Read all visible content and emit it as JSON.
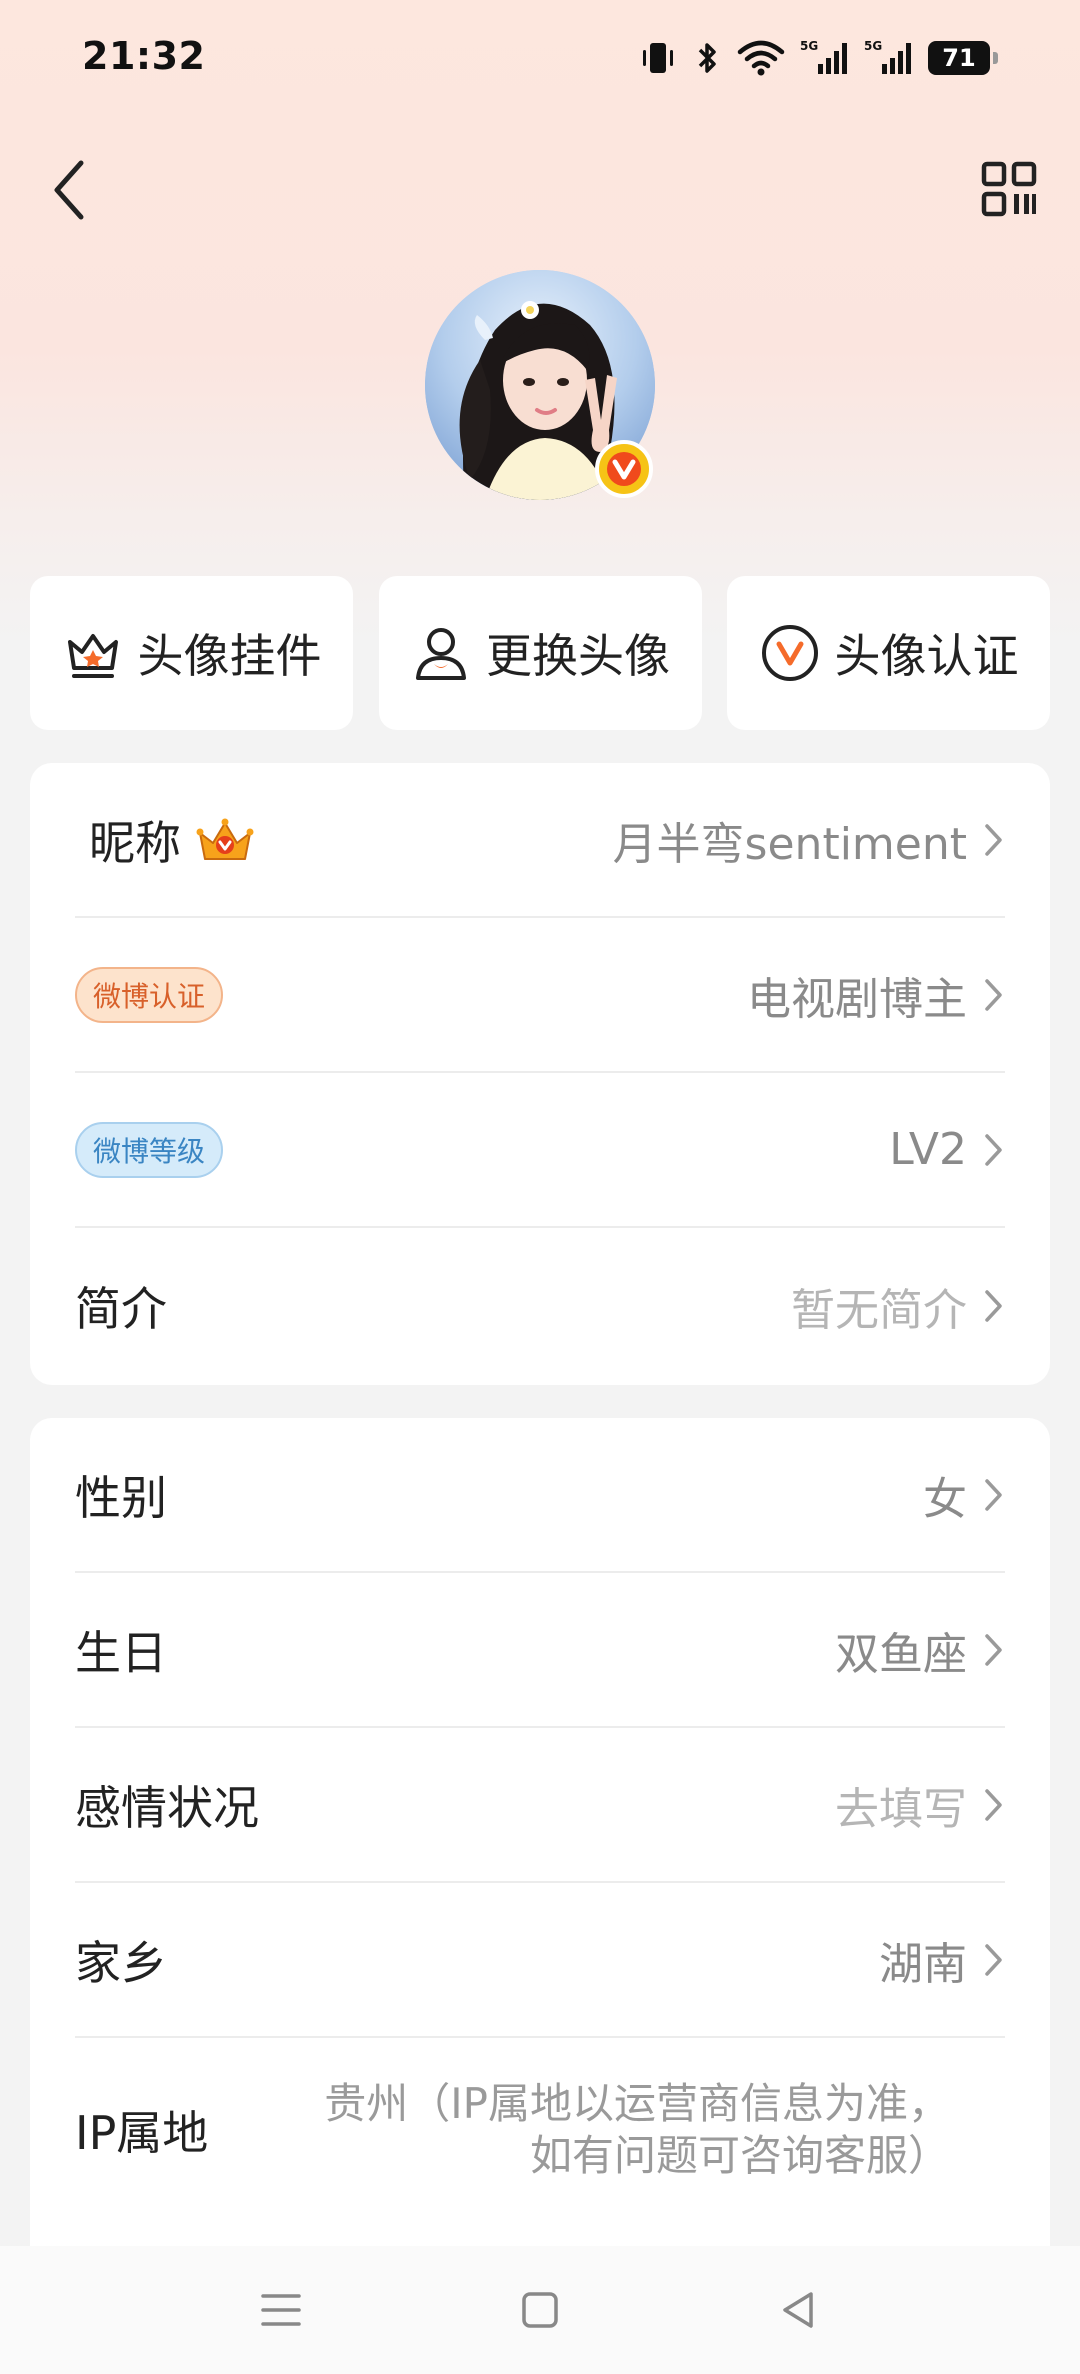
{
  "status_bar": {
    "time": "21:32",
    "battery": "71",
    "network_1": "5G",
    "network_2": "5G"
  },
  "icons": {
    "back": "back-chevron-icon",
    "qr": "qr-code-icon",
    "verified": "verified-v-icon",
    "crown": "crown-icon"
  },
  "quick_actions": [
    {
      "label": "头像挂件",
      "icon": "crown-outline-icon"
    },
    {
      "label": "更换头像",
      "icon": "person-icon"
    },
    {
      "label": "头像认证",
      "icon": "v-circle-icon"
    }
  ],
  "profile_card": {
    "nickname": {
      "label": "昵称",
      "value": "月半弯sentiment"
    },
    "weibo_auth": {
      "label": "微博认证",
      "value": "电视剧博主"
    },
    "weibo_level": {
      "label": "微博等级",
      "value": "LV2"
    },
    "bio": {
      "label": "简介",
      "value": "暂无简介"
    }
  },
  "info_card": {
    "gender": {
      "label": "性别",
      "value": "女"
    },
    "birthday": {
      "label": "生日",
      "value": "双鱼座"
    },
    "relationship": {
      "label": "感情状况",
      "value": "去填写"
    },
    "hometown": {
      "label": "家乡",
      "value": "湖南"
    },
    "ip": {
      "label": "IP属地",
      "value_line1": "贵州（IP属地以运营商信息为准，",
      "value_line2": "如有问题可咨询客服）"
    }
  },
  "colors": {
    "accent_orange": "#f7931e",
    "verified_yellow": "#f6c316",
    "auth_tag": "#d8602a",
    "level_tag": "#3a85c3"
  }
}
